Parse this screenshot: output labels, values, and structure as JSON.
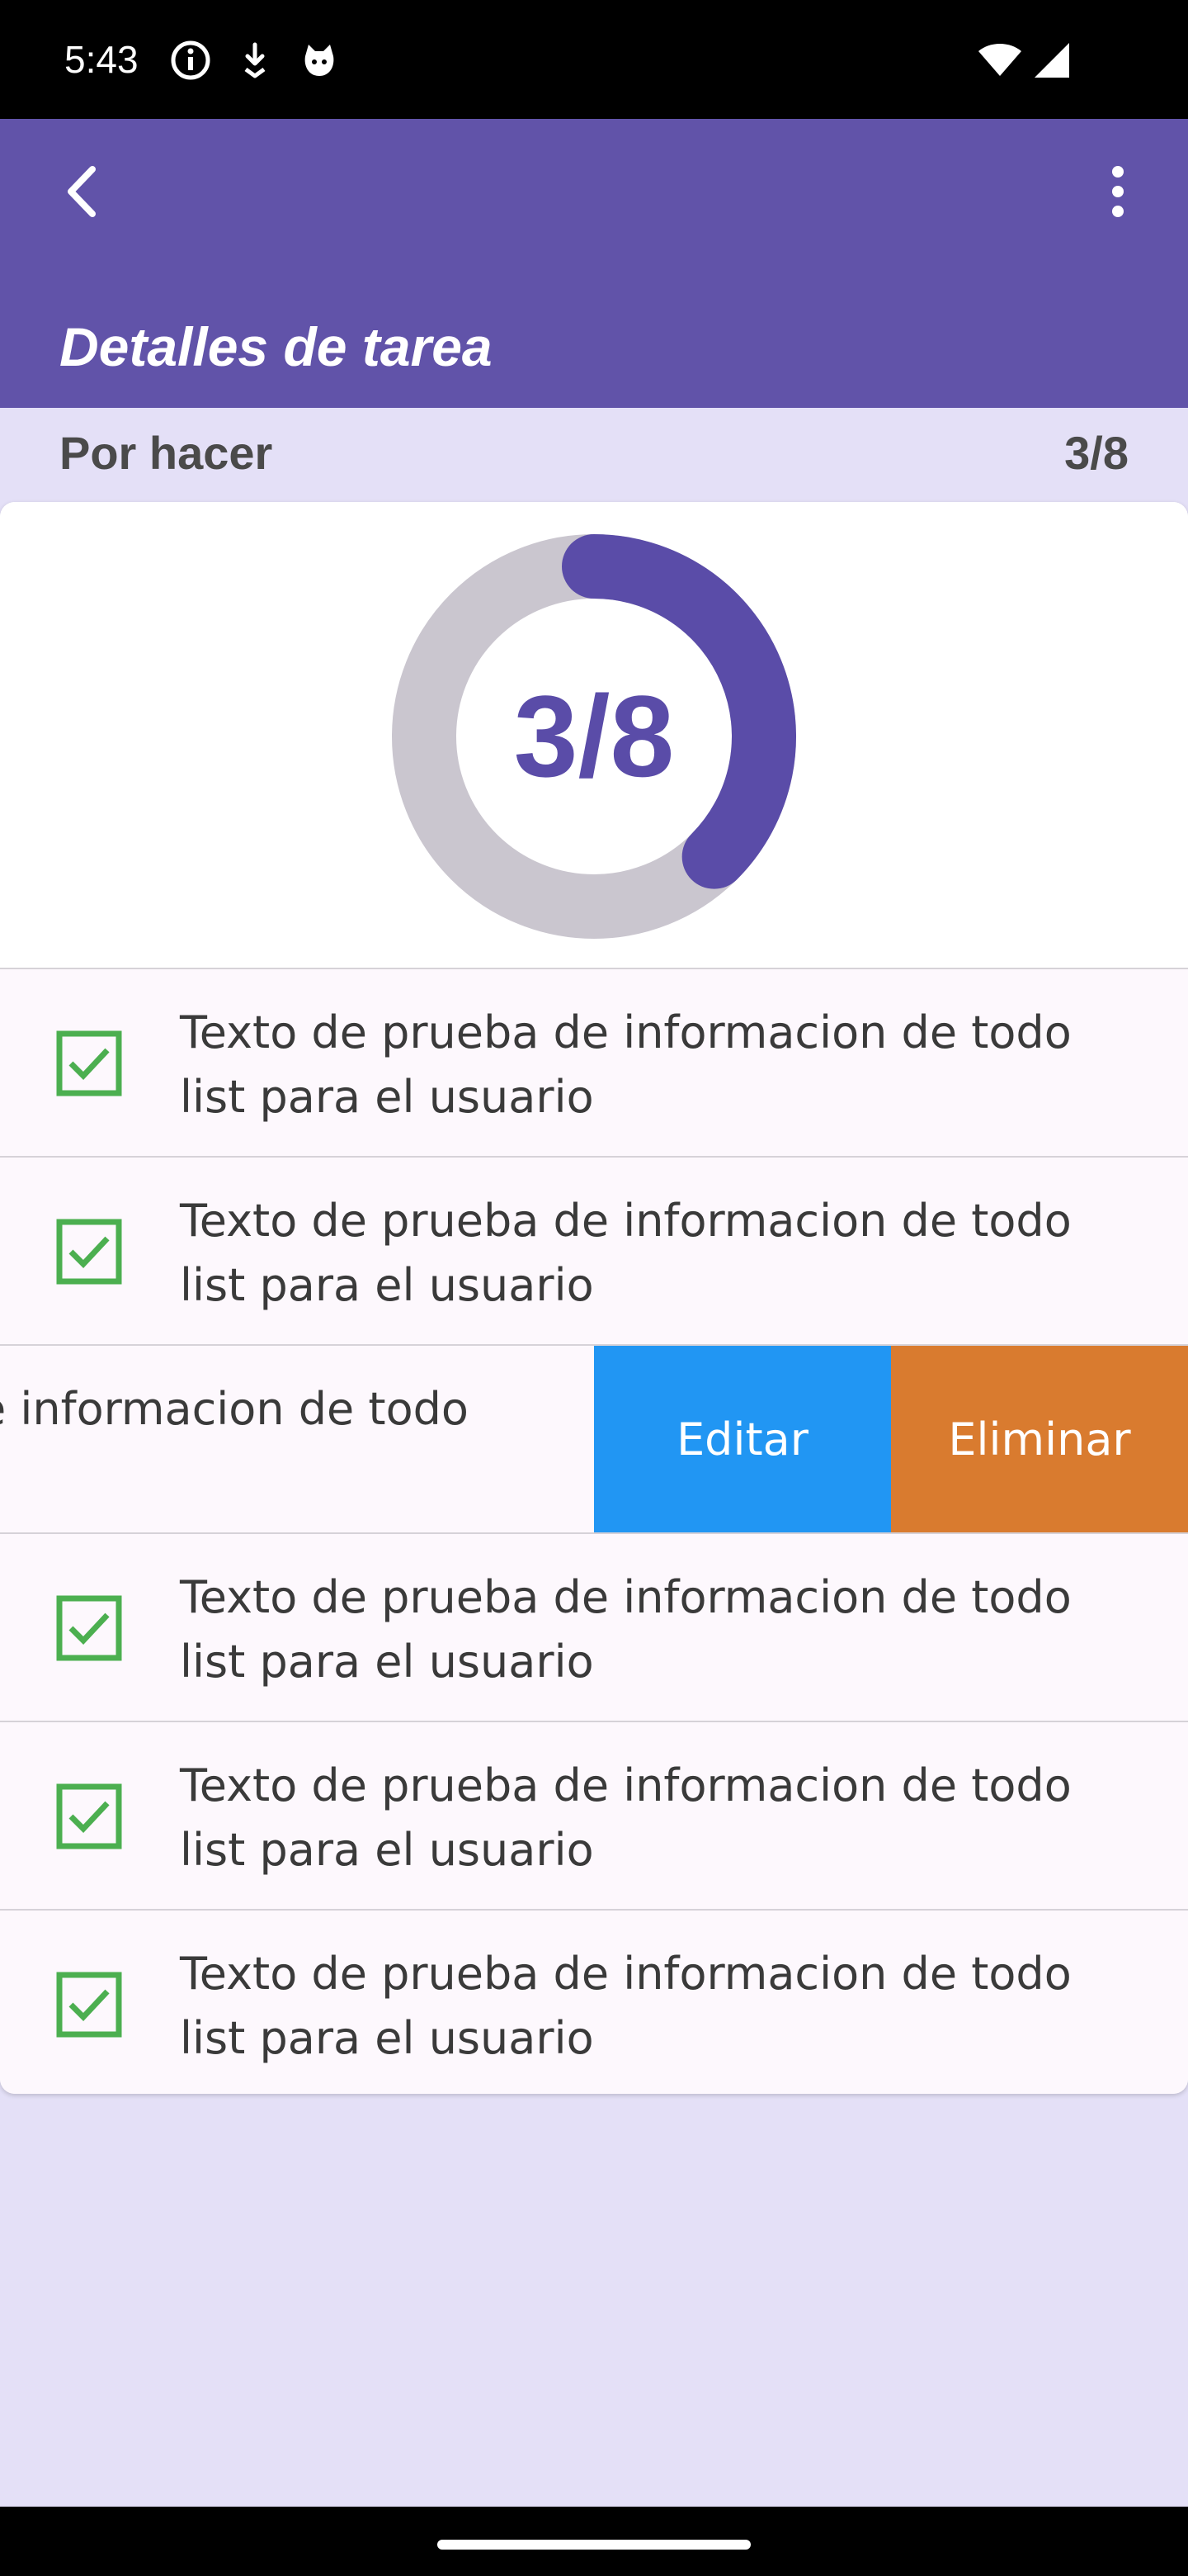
{
  "status_bar": {
    "time": "5:43",
    "icons": [
      "info-icon",
      "download-icon",
      "cat-icon",
      "wifi-icon",
      "signal-icon"
    ]
  },
  "app_bar": {
    "title": "Detalles de tarea",
    "back_icon": "back-chevron-icon",
    "menu_icon": "more-vertical-icon",
    "color": "#6153a9"
  },
  "section": {
    "label": "Por hacer",
    "count": "3/8"
  },
  "progress": {
    "label": "3/8",
    "completed": 3,
    "total": 8,
    "fill_color": "#5a4ca8",
    "track_color": "#cac6cf"
  },
  "todos": [
    {
      "text": "Texto de prueba de informacion de todo list para el usuario",
      "checked": true
    },
    {
      "text": "Texto de prueba de informacion de todo list para el usuario",
      "checked": true
    },
    {
      "text": "e informacion de todo",
      "checked": true
    },
    {
      "text": "Texto de prueba de informacion de todo list para el usuario",
      "checked": true
    },
    {
      "text": "Texto de prueba de informacion de todo list para el usuario",
      "checked": true
    },
    {
      "text": "Texto de prueba de informacion de todo list para el usuario",
      "checked": true
    }
  ],
  "swipe_actions": {
    "edit_label": "Editar",
    "delete_label": "Eliminar",
    "edit_color": "#2196f3",
    "delete_color": "#d97b2f"
  },
  "colors": {
    "background": "#e4e0f7",
    "checkbox": "#4caf50"
  }
}
